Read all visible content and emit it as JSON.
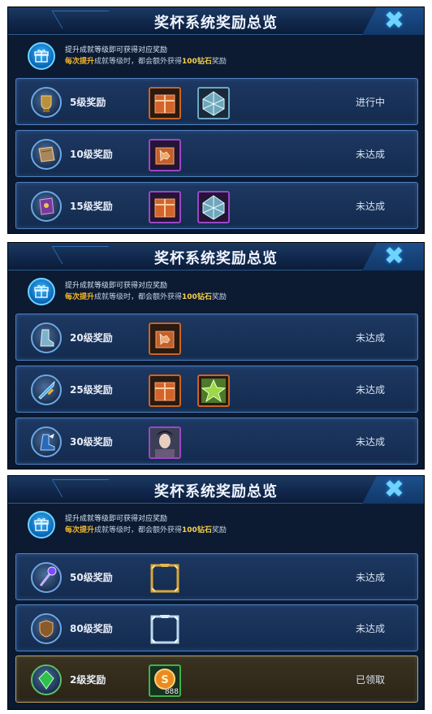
{
  "panels": [
    {
      "title": "奖杯系统奖励总览",
      "notice_line1": "提升成就等级即可获得对应奖励",
      "notice_line2_a": "每次提升",
      "notice_line2_b": "成就等级时，都会额外获得",
      "notice_line2_c": "100钻石",
      "notice_line2_d": "奖励",
      "rows": [
        {
          "level": "5级奖励",
          "status": "进行中",
          "items": [
            "orange-chest",
            "diamond-chest"
          ],
          "badge": "trophy-bronze-icon"
        },
        {
          "level": "10级奖励",
          "status": "未达成",
          "items": [
            "purple-fragment-chest"
          ],
          "badge": "book-icon"
        },
        {
          "level": "15级奖励",
          "status": "未达成",
          "items": [
            "orange-chest",
            "diamond-chest"
          ],
          "badge": "spellbook-icon"
        }
      ]
    },
    {
      "title": "奖杯系统奖励总览",
      "notice_line1": "提升成就等级即可获得对应奖励",
      "notice_line2_a": "每次提升",
      "notice_line2_b": "成就等级时，都会额外获得",
      "notice_line2_c": "100钻石",
      "notice_line2_d": "奖励",
      "rows": [
        {
          "level": "20级奖励",
          "status": "未达成",
          "items": [
            "orange-fragment-chest"
          ],
          "badge": "boots-icon"
        },
        {
          "level": "25级奖励",
          "status": "未达成",
          "items": [
            "orange-chest",
            "green-star-chest"
          ],
          "badge": "sword-icon"
        },
        {
          "level": "30级奖励",
          "status": "未达成",
          "items": [
            "hero-portrait"
          ],
          "badge": "winged-boot-icon"
        }
      ]
    },
    {
      "title": "奖杯系统奖励总览",
      "notice_line1": "提升成就等级即可获得对应奖励",
      "notice_line2_a": "每次提升",
      "notice_line2_b": "成就等级时，都会额外获得",
      "notice_line2_c": "100钻石",
      "notice_line2_d": "奖励",
      "rows": [
        {
          "level": "50级奖励",
          "status": "未达成",
          "items": [
            "gold-frame"
          ],
          "badge": "magic-staff-icon"
        },
        {
          "level": "80级奖励",
          "status": "未达成",
          "items": [
            "silver-frame"
          ],
          "badge": "armor-icon"
        },
        {
          "level": "2级奖励",
          "status": "已领取",
          "items": [
            "gold-coin"
          ],
          "item_count": "888",
          "badge": "emerald-icon"
        }
      ]
    }
  ],
  "colors": {
    "accent": "#6fd3ff",
    "highlight_orange": "#f5b72a",
    "claimed_border": "#c8a14a"
  }
}
